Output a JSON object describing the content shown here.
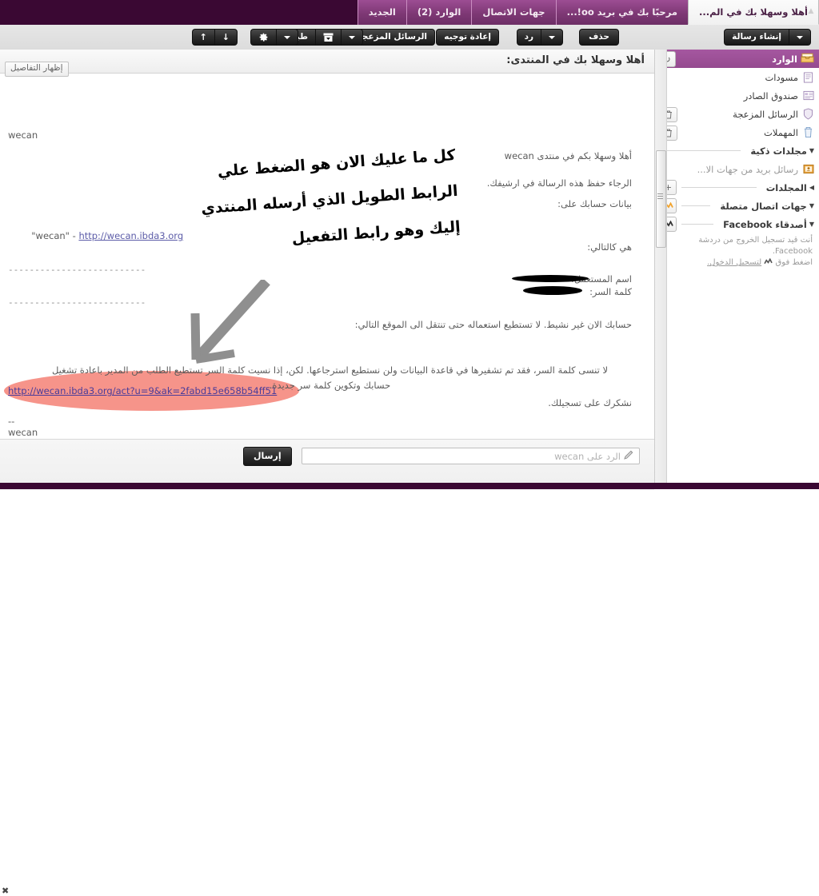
{
  "window": {
    "scroll_up_icon": "triangle-up"
  },
  "tabs": [
    {
      "label": "أهلا وسهلا بك في الم...",
      "active": true
    },
    {
      "label": "مرحبًا بك في بريد oo!...",
      "active": false
    },
    {
      "label": "جهات الاتصال",
      "active": false
    },
    {
      "label": "الوارد (2)",
      "active": false
    },
    {
      "label": "الجديد",
      "active": false
    }
  ],
  "toolbar": {
    "compose_label": "إنشاء رسالة",
    "compose_caret": "▼",
    "delete_label": "حذف",
    "reply_label": "رد",
    "reply_caret": "▼",
    "forward_label": "إعادة توجيه",
    "spam_label": "الرسائل المزعجة",
    "archive_caret": "▼",
    "archive_icon": "archive-box-icon",
    "print_label": "طباعة",
    "gear_icon": "⚙",
    "gear_caret": "▼",
    "prev_icon": "↑",
    "next_icon": "↓"
  },
  "sidebar": {
    "header": {
      "title": "الوارد",
      "icon": "inbox-icon",
      "refresh_icon": "↻"
    },
    "items": [
      {
        "label": "مسودات",
        "icon": "drafts-icon",
        "trash": false
      },
      {
        "label": "صندوق الصادر",
        "icon": "outbox-icon",
        "trash": false
      },
      {
        "label": "الرسائل المزعجة",
        "icon": "shield-icon",
        "trash": true,
        "trash_icon": "🗑"
      },
      {
        "label": "المهملات",
        "icon": "trash-icon",
        "trash": true,
        "trash_icon": "🗑"
      }
    ],
    "groups": [
      {
        "label": "مجلدات ذكية",
        "caret": "▼",
        "button": null
      },
      {
        "label": "المجلدات",
        "caret": "◀",
        "button": "+"
      },
      {
        "label": "جهات اتصال متصلة",
        "caret": "▼",
        "button": "messenger-icon"
      },
      {
        "label": "أصدقاء Facebook",
        "caret": "▼",
        "button": "messenger-icon"
      }
    ],
    "smart_folder": {
      "label": "رسائل بريد من جهات الا...",
      "icon": "contacts-icon"
    },
    "facebook_note_line1": "أنت قيد تسجيل الخروج من دردشة Facebook.",
    "facebook_note_line2_before": "اضغط فوق",
    "facebook_note_link": "لتسجيل الدخول.",
    "facebook_note_icon": "messenger-icon"
  },
  "message": {
    "subject": "أهلا وسهلا بك في المنتدى:",
    "details_button": "إظهار التفاصيل",
    "sender_line_top": "wecan",
    "greeting": "أهلا وسهلا بكم في منتدى wecan",
    "archive_request": "الرجاء حفظ هذه الرسالة في ارشيفك.",
    "account_data_label": "بيانات حسابك على:",
    "site_quote": "\"wecan\" - ",
    "site_link": "http://wecan.ibda3.org",
    "as_follows": "هي كالتالي:",
    "username_label": "اسم المستعمل:",
    "password_label": "كلمة السر:",
    "inactive_notice": "حسابك الان غير نشيط. لا تستطيع استعماله حتى تنتقل الى الموقع التالي:",
    "activation_link": "http://wecan.ibda3.org/act?u=9&ak=2fabd15e658b54ff51",
    "password_warning_line1": "لا تنسى كلمة السر، فقد تم تشفيرها في قاعدة البيانات ولن نستطيع استرجاعها. لكن، إذا نسيت كلمة السر تستطيع الطلب من المدير باعادة تشغيل",
    "password_warning_line2": "حسابك وتكوين كلمة سر جديدة.",
    "thanks": "نشكرك على تسجيلك.",
    "sig_dashes": "--",
    "sig_name": "wecan",
    "divider1": "--------------------------",
    "divider2": "--------------------------",
    "redaction_note": "redacted-username-and-password"
  },
  "annotation": {
    "line1": "كل ما عليك الان هو الضغط علي",
    "line2": "الرابط الطويل الذي أرسله المنتدي",
    "line3": "إليك وهو رابط التفعيل",
    "arrow": "hand-drawn-arrow-icon",
    "highlight_color": "#f58e84"
  },
  "reply": {
    "placeholder": "الرد على wecan",
    "pencil_icon": "pencil-icon",
    "send_label": "إرسال",
    "close_icon": "✖"
  },
  "colors": {
    "header_purple": "#3a0833",
    "tab_purple": "#8c3f83",
    "sidebar_header": "#9c4d93",
    "link": "#5c5ca8",
    "highlight": "#f58e84"
  }
}
